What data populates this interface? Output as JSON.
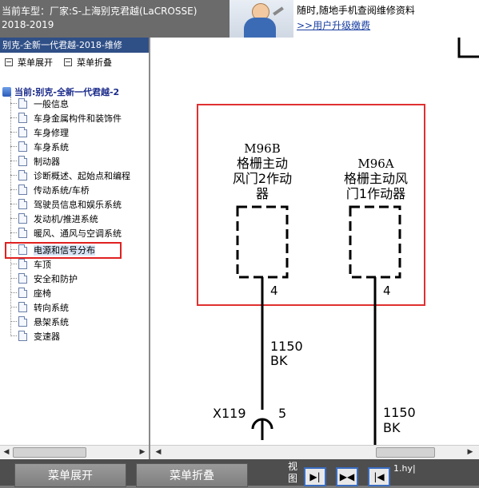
{
  "header": {
    "vehicle_line": "当前车型：厂家:S-上海别克君越(LaCROSSE)",
    "years": "2018-2019",
    "ad": {
      "line1": "随时,随地手机查阅维修资料",
      "link": ">>用户升级缴费"
    }
  },
  "left_panel": {
    "title": "别克-全新一代君越-2018-维修",
    "expand_label": "菜单展开",
    "collapse_label": "菜单折叠",
    "tree_root": "当前:别克-全新一代君越-2",
    "items": [
      {
        "label": "一般信息"
      },
      {
        "label": "车身金属构件和装饰件"
      },
      {
        "label": "车身修理"
      },
      {
        "label": "车身系统"
      },
      {
        "label": "制动器"
      },
      {
        "label": "诊断概述、起始点和编程"
      },
      {
        "label": "传动系统/车桥"
      },
      {
        "label": "驾驶员信息和娱乐系统"
      },
      {
        "label": "发动机/推进系统"
      },
      {
        "label": "暖风、通风与空调系统"
      },
      {
        "label": "电源和信号分布",
        "selected": true
      },
      {
        "label": "车顶"
      },
      {
        "label": "安全和防护"
      },
      {
        "label": "座椅"
      },
      {
        "label": "转向系统"
      },
      {
        "label": "悬架系统"
      },
      {
        "label": "变速器"
      }
    ]
  },
  "diagram": {
    "component_b": {
      "code": "M96B",
      "name_line1": "格栅主动",
      "name_line2": "风门2作动",
      "name_line3": "器",
      "pin": "4"
    },
    "component_a": {
      "code": "M96A",
      "name_line1": "格栅主动风",
      "name_line2": "门1作动器",
      "pin": "4"
    },
    "wire_left": {
      "circuit": "1150",
      "color": "BK"
    },
    "wire_right": {
      "circuit": "1150",
      "color": "BK"
    },
    "connector": {
      "name": "X119",
      "pin": "5"
    },
    "highlight_color": "#e03030"
  },
  "bottom_bar": {
    "expand_button": "菜单展开",
    "collapse_button": "菜单折叠",
    "view_label": "视图",
    "nav_buttons": [
      "▶|",
      "▶◀",
      "|◀"
    ],
    "file_label": "1.hy|"
  }
}
